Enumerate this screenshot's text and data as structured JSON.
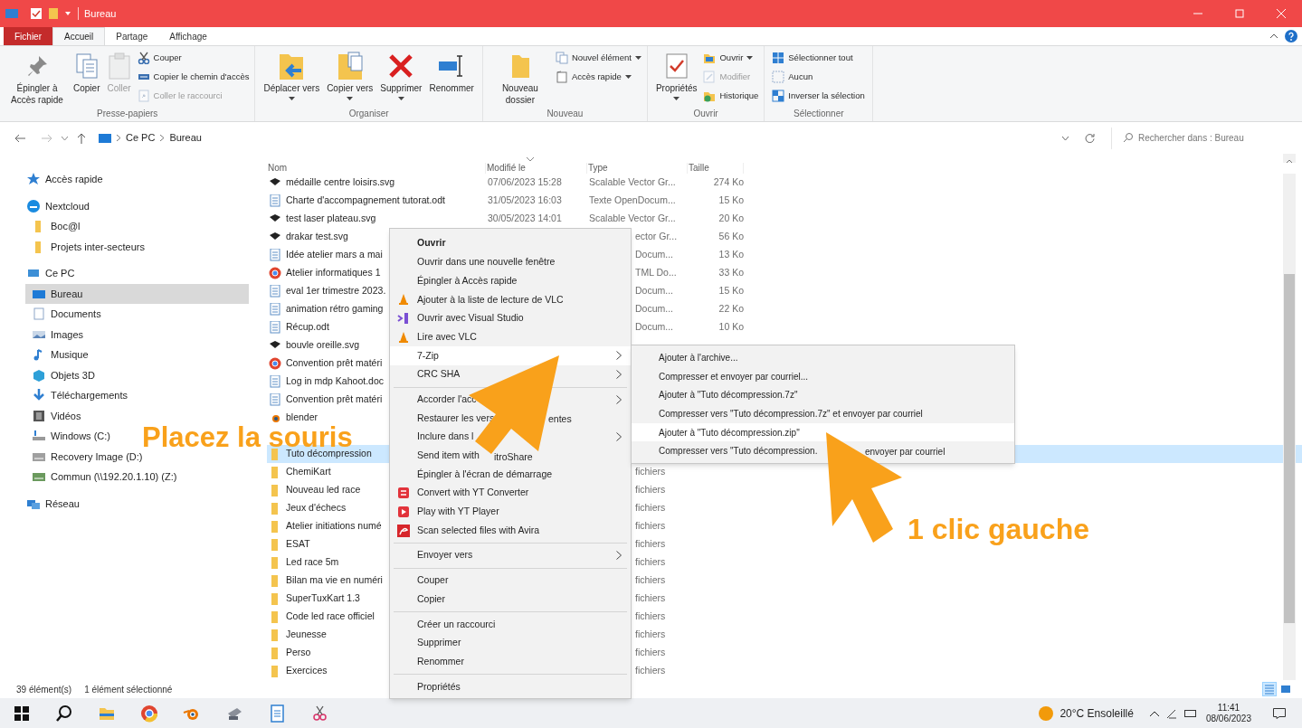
{
  "window": {
    "title": "Bureau"
  },
  "ribbon_tabs": [
    {
      "label": "Fichier",
      "kind": "file",
      "selected": false
    },
    {
      "label": "Accueil",
      "kind": "tab",
      "selected": true
    },
    {
      "label": "Partage",
      "kind": "tab",
      "selected": false
    },
    {
      "label": "Affichage",
      "kind": "tab",
      "selected": false
    }
  ],
  "ribbon": [
    {
      "label": "Presse-papiers",
      "large": [
        {
          "label": "Épingler à Accès rapide",
          "dropdown": false,
          "disabled": false
        },
        {
          "label": "Copier",
          "dropdown": false,
          "disabled": false
        },
        {
          "label": "Coller",
          "dropdown": false,
          "disabled": true
        }
      ],
      "small": [
        {
          "label": "Couper",
          "dropdown": false,
          "disabled": false
        },
        {
          "label": "Copier le chemin d'accès",
          "dropdown": false,
          "disabled": false
        },
        {
          "label": "Coller le raccourci",
          "dropdown": false,
          "disabled": true
        }
      ]
    },
    {
      "label": "Organiser",
      "large": [
        {
          "label": "Déplacer vers",
          "dropdown": true,
          "disabled": false
        },
        {
          "label": "Copier vers",
          "dropdown": true,
          "disabled": false
        },
        {
          "label": "Supprimer",
          "dropdown": true,
          "disabled": false
        },
        {
          "label": "Renommer",
          "dropdown": false,
          "disabled": false
        }
      ]
    },
    {
      "label": "Nouveau",
      "large": [
        {
          "label": "Nouveau dossier",
          "dropdown": false,
          "disabled": false
        }
      ],
      "small": [
        {
          "label": "Nouvel élément",
          "dropdown": true,
          "disabled": false
        },
        {
          "label": "Accès rapide",
          "dropdown": true,
          "disabled": false
        }
      ]
    },
    {
      "label": "Ouvrir",
      "large": [
        {
          "label": "Propriétés",
          "dropdown": true,
          "disabled": false
        }
      ],
      "small": [
        {
          "label": "Ouvrir",
          "dropdown": true,
          "disabled": false
        },
        {
          "label": "Modifier",
          "dropdown": false,
          "disabled": true
        },
        {
          "label": "Historique",
          "dropdown": false,
          "disabled": false
        }
      ]
    },
    {
      "label": "Sélectionner",
      "small": [
        {
          "label": "Sélectionner tout",
          "dropdown": false,
          "disabled": false
        },
        {
          "label": "Aucun",
          "dropdown": false,
          "disabled": false
        },
        {
          "label": "Inverser la sélection",
          "dropdown": false,
          "disabled": false
        }
      ]
    }
  ],
  "address_bar": {
    "path": [
      "Ce PC",
      "Bureau"
    ]
  },
  "search": {
    "placeholder": "Rechercher dans : Bureau"
  },
  "sidebar": [
    {
      "label": "Accès rapide",
      "selected": false
    },
    {
      "label": "Nextcloud",
      "selected": false,
      "children": [
        {
          "label": "Boc@l",
          "selected": false
        },
        {
          "label": "Projets inter-secteurs",
          "selected": false
        }
      ]
    },
    {
      "label": "Ce PC",
      "selected": false,
      "children": [
        {
          "label": "Bureau",
          "selected": true
        },
        {
          "label": "Documents",
          "selected": false
        },
        {
          "label": "Images",
          "selected": false
        },
        {
          "label": "Musique",
          "selected": false
        },
        {
          "label": "Objets 3D",
          "selected": false
        },
        {
          "label": "Téléchargements",
          "selected": false
        },
        {
          "label": "Vidéos",
          "selected": false
        },
        {
          "label": "Windows (C:)",
          "selected": false
        },
        {
          "label": "Recovery Image (D:)",
          "selected": false
        },
        {
          "label": "Commun (\\\\192.20.1.10) (Z:)",
          "selected": false
        }
      ]
    },
    {
      "label": "Réseau",
      "selected": false
    }
  ],
  "file_list": {
    "columns": [
      "Nom",
      "Modifié le",
      "Type",
      "Taille"
    ],
    "rows": [
      {
        "kind": "svg",
        "name": "médaille centre loisirs.svg",
        "modified": "07/06/2023 15:28",
        "type": "Scalable Vector Gr...",
        "size": "274 Ko",
        "selected": false
      },
      {
        "kind": "odt",
        "name": "Charte d'accompagnement tutorat.odt",
        "modified": "31/05/2023 16:03",
        "type": "Texte OpenDocum...",
        "size": "15 Ko",
        "selected": false
      },
      {
        "kind": "svg",
        "name": "test laser plateau.svg",
        "modified": "30/05/2023 14:01",
        "type": "Scalable Vector Gr...",
        "size": "20 Ko",
        "selected": false
      },
      {
        "kind": "svg",
        "name": "drakar test.svg",
        "type": "ector Gr...",
        "size": "56 Ko",
        "selected": false
      },
      {
        "kind": "odt",
        "name": "Idée atelier mars a mai",
        "type": "Docum...",
        "size": "13 Ko",
        "selected": false
      },
      {
        "kind": "html",
        "name": "Atelier informatiques 1",
        "type": "TML Do...",
        "size": "33 Ko",
        "selected": false
      },
      {
        "kind": "odt",
        "name": "eval 1er trimestre 2023.",
        "type": "Docum...",
        "size": "15 Ko",
        "selected": false
      },
      {
        "kind": "odt",
        "name": "animation rétro gaming",
        "type": "Docum...",
        "size": "22 Ko",
        "selected": false
      },
      {
        "kind": "odt",
        "name": "Récup.odt",
        "type": "Docum...",
        "size": "10 Ko",
        "selected": false
      },
      {
        "kind": "svg",
        "name": "bouvle oreille.svg",
        "selected": false
      },
      {
        "kind": "html",
        "name": "Convention prêt matéri",
        "selected": false
      },
      {
        "kind": "odt",
        "name": "Log in mdp Kahoot.doc",
        "selected": false
      },
      {
        "kind": "odt",
        "name": "Convention prêt matéri",
        "selected": false
      },
      {
        "kind": "blender",
        "name": "blender",
        "selected": false
      },
      {
        "kind": "covered",
        "selected": false
      },
      {
        "kind": "folder",
        "name": "Tuto décompression",
        "selected": true
      },
      {
        "kind": "folder",
        "name": "ChemiKart",
        "type": "fichiers",
        "selected": false
      },
      {
        "kind": "folder",
        "name": "Nouveau led race",
        "type": "fichiers",
        "selected": false
      },
      {
        "kind": "folder",
        "name": "Jeux d'échecs",
        "type": "fichiers",
        "selected": false
      },
      {
        "kind": "folder",
        "name": "Atelier initiations numé",
        "type": "fichiers",
        "selected": false
      },
      {
        "kind": "folder",
        "name": "ESAT",
        "type": "fichiers",
        "selected": false
      },
      {
        "kind": "folder",
        "name": "Led race 5m",
        "type": "fichiers",
        "selected": false
      },
      {
        "kind": "folder",
        "name": "Bilan ma vie en numéri",
        "type": "fichiers",
        "selected": false
      },
      {
        "kind": "folder",
        "name": "SuperTuxKart 1.3",
        "type": "fichiers",
        "selected": false
      },
      {
        "kind": "folder",
        "name": "Code led race officiel",
        "type": "fichiers",
        "selected": false
      },
      {
        "kind": "folder",
        "name": "Jeunesse",
        "type": "fichiers",
        "selected": false
      },
      {
        "kind": "folder",
        "name": "Perso",
        "type": "fichiers",
        "selected": false
      },
      {
        "kind": "folder",
        "name": "Exercices",
        "type": "fichiers",
        "selected": false
      }
    ]
  },
  "context_menu": [
    {
      "kind": "item",
      "label": "Ouvrir",
      "default": true,
      "submenu": false,
      "selected": false
    },
    {
      "kind": "item",
      "label": "Ouvrir dans une nouvelle fenêtre",
      "default": false,
      "submenu": false,
      "selected": false
    },
    {
      "kind": "item",
      "label": "Épingler à Accès rapide",
      "default": false,
      "submenu": false,
      "selected": false
    },
    {
      "kind": "item",
      "label": "Ajouter à la liste de lecture de VLC",
      "default": false,
      "submenu": false,
      "selected": false
    },
    {
      "kind": "item",
      "label": "Ouvrir avec Visual Studio",
      "default": false,
      "submenu": false,
      "selected": false
    },
    {
      "kind": "item",
      "label": "Lire avec VLC",
      "default": false,
      "submenu": false,
      "selected": false
    },
    {
      "kind": "item",
      "label": "7-Zip",
      "default": false,
      "submenu": true,
      "selected": true
    },
    {
      "kind": "item",
      "label": "CRC SHA",
      "default": false,
      "submenu": true,
      "selected": false
    },
    {
      "kind": "separator"
    },
    {
      "kind": "item",
      "label": "Accorder l'acc",
      "default": false,
      "submenu": true,
      "selected": false
    },
    {
      "kind": "item",
      "label": "Restaurer les vers",
      "label_end": "entes",
      "default": false,
      "submenu": false,
      "selected": false
    },
    {
      "kind": "item",
      "label": "Inclure dans l",
      "default": false,
      "submenu": true,
      "selected": false
    },
    {
      "kind": "item",
      "label": "Send item with",
      "label_end": "itroShare",
      "default": false,
      "submenu": false,
      "selected": false
    },
    {
      "kind": "item",
      "label": "Épingler à l'écran de démarrage",
      "default": false,
      "submenu": false,
      "selected": false
    },
    {
      "kind": "item",
      "label": "Convert with YT Converter",
      "default": false,
      "submenu": false,
      "selected": false
    },
    {
      "kind": "item",
      "label": "Play with YT Player",
      "default": false,
      "submenu": false,
      "selected": false
    },
    {
      "kind": "item",
      "label": "Scan selected files with Avira",
      "default": false,
      "submenu": false,
      "selected": false
    },
    {
      "kind": "separator"
    },
    {
      "kind": "item",
      "label": "Envoyer vers",
      "default": false,
      "submenu": true,
      "selected": false
    },
    {
      "kind": "separator"
    },
    {
      "kind": "item",
      "label": "Couper",
      "default": false,
      "submenu": false,
      "selected": false
    },
    {
      "kind": "item",
      "label": "Copier",
      "default": false,
      "submenu": false,
      "selected": false
    },
    {
      "kind": "separator"
    },
    {
      "kind": "item",
      "label": "Créer un raccourci",
      "default": false,
      "submenu": false,
      "selected": false
    },
    {
      "kind": "item",
      "label": "Supprimer",
      "default": false,
      "submenu": false,
      "selected": false
    },
    {
      "kind": "item",
      "label": "Renommer",
      "default": false,
      "submenu": false,
      "selected": false
    },
    {
      "kind": "separator"
    },
    {
      "kind": "item",
      "label": "Propriétés",
      "default": false,
      "submenu": false,
      "selected": false
    }
  ],
  "submenu": [
    {
      "label": "Ajouter à l'archive...",
      "selected": false
    },
    {
      "label": "Compresser et envoyer par courriel...",
      "selected": false
    },
    {
      "label": "Ajouter à \"Tuto décompression.7z\"",
      "selected": false
    },
    {
      "label": "Compresser vers \"Tuto décompression.7z\" et envoyer par courriel",
      "selected": false
    },
    {
      "label": "Ajouter à \"Tuto décompression.zip\"",
      "selected": true
    },
    {
      "label": "Compresser vers \"Tuto décompression.",
      "label_end": "envoyer par courriel",
      "selected": false
    }
  ],
  "status_bar": {
    "count": "39 élément(s)",
    "selection": "1 élément sélectionné",
    "views": [
      {
        "selected": true
      },
      {
        "selected": false
      }
    ]
  },
  "annotations": [
    {
      "text": "Placez la souris"
    },
    {
      "text": "1 clic gauche"
    }
  ],
  "taskbar": {
    "weather": "20°C Ensoleillé",
    "time": "11:41",
    "date": "08/06/2023"
  }
}
